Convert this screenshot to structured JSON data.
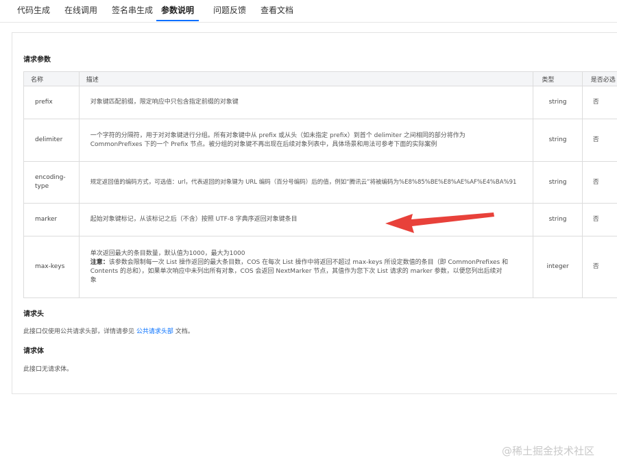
{
  "tabs": [
    {
      "label": "代码生成"
    },
    {
      "label": "在线调用"
    },
    {
      "label": "签名串生成"
    },
    {
      "label": "参数说明",
      "active": true
    },
    {
      "label": "问题反馈"
    },
    {
      "label": "查看文档"
    }
  ],
  "request_params": {
    "title": "请求参数",
    "headers": {
      "name": "名称",
      "desc": "描述",
      "type": "类型",
      "required": "是否必选"
    },
    "rows": [
      {
        "name": "prefix",
        "desc": "对象键匹配前缀，限定响应中只包含指定前缀的对象键",
        "type": "string",
        "required": "否"
      },
      {
        "name": "delimiter",
        "desc_lines": [
          "一个字符的分隔符，用于对对象键进行分组。所有对象键中从 prefix 或从头（如未指定 prefix）到首个 delimiter 之间相同的部分将作为",
          "CommonPrefixes 下的一个 Prefix 节点。被分组的对象键不再出现在后续对象列表中，具体场景和用法可参考下面的实际案例"
        ],
        "type": "string",
        "required": "否"
      },
      {
        "name_lines": [
          "encoding-",
          "type"
        ],
        "desc": "规定返回值的编码方式，可选值：url，代表返回的对象键为 URL 编码（百分号编码）后的值，例如“腾讯云”将被编码为%E8%85%BE%E8%AE%AF%E4%BA%91",
        "type": "string",
        "required": "否"
      },
      {
        "name": "marker",
        "desc": "起始对象键标记，从该标记之后（不含）按照 UTF-8 字典序返回对象键条目",
        "type": "string",
        "required": "否"
      },
      {
        "name": "max-keys",
        "desc_first": "单次返回最大的条目数量，默认值为1000，最大为1000",
        "note_label": "注意：",
        "note_lines": [
          "该参数会限制每一次 List 操作返回的最大条目数，COS 在每次 List 操作中将返回不超过 max-keys 所设定数值的条目（即 CommonPrefixes 和",
          "Contents 的总和），如果单次响应中未列出所有对象，COS 会返回 NextMarker 节点，其值作为您下次 List 请求的 marker 参数，以便您列出后续对",
          "象"
        ],
        "type": "integer",
        "required": "否"
      }
    ]
  },
  "request_headers": {
    "title": "请求头",
    "text_before": "此接口仅使用公共请求头部，详情请参见 ",
    "link": "公共请求头部",
    "text_after": " 文档。"
  },
  "request_body": {
    "title": "请求体",
    "text": "此接口无请求体。"
  },
  "watermark": "@稀土掘金技术社区",
  "colors": {
    "accent": "#006eff",
    "arrow": "#e8413a"
  }
}
